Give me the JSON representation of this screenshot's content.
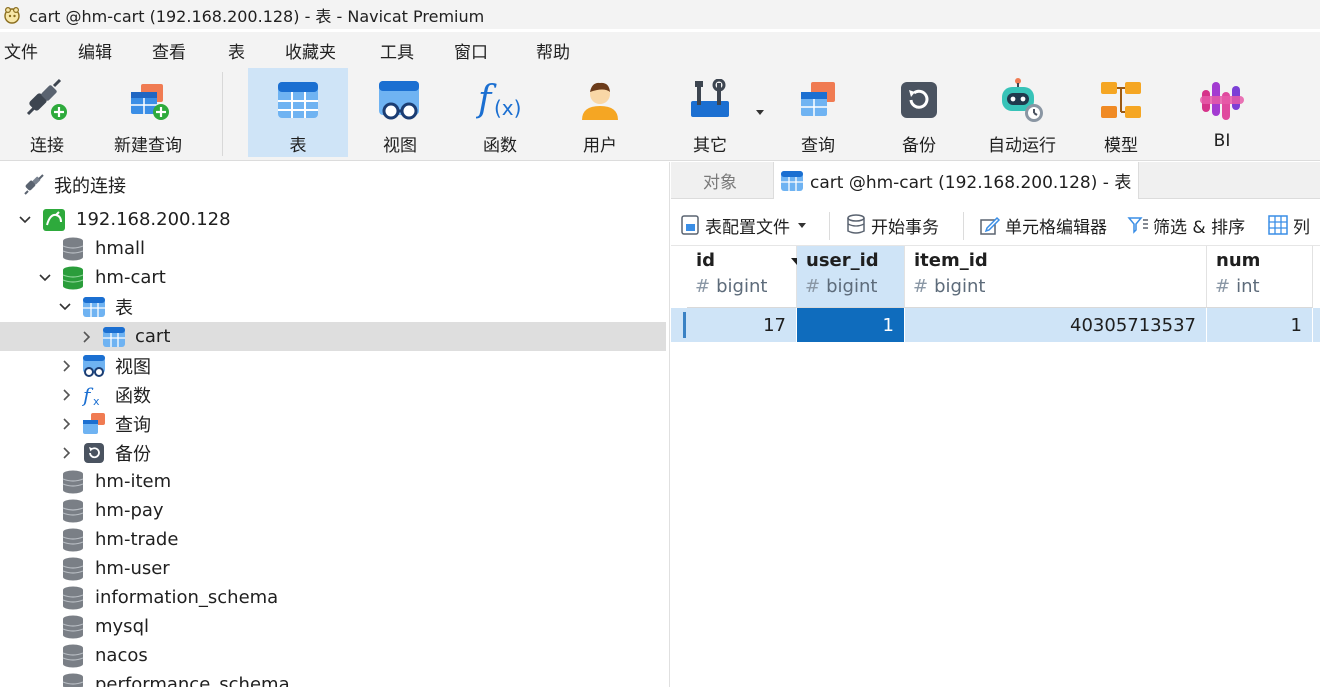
{
  "window": {
    "title": "cart @hm-cart (192.168.200.128) - 表 - Navicat Premium"
  },
  "menu": [
    "文件",
    "编辑",
    "查看",
    "表",
    "收藏夹",
    "工具",
    "窗口",
    "帮助"
  ],
  "toolbar": {
    "connect": "连接",
    "new_query": "新建查询",
    "table": "表",
    "view": "视图",
    "function": "函数",
    "user": "用户",
    "other": "其它",
    "query": "查询",
    "backup": "备份",
    "automation": "自动运行",
    "model": "模型",
    "bi": "BI"
  },
  "tree": {
    "root": "我的连接",
    "connection": "192.168.200.128",
    "items": {
      "hmall": "hmall",
      "hm_cart": "hm-cart",
      "tables": "表",
      "cart": "cart",
      "views": "视图",
      "functions": "函数",
      "queries": "查询",
      "backups": "备份",
      "hm_item": "hm-item",
      "hm_pay": "hm-pay",
      "hm_trade": "hm-trade",
      "hm_user": "hm-user",
      "information_schema": "information_schema",
      "mysql": "mysql",
      "nacos": "nacos",
      "performance_schema": "performance_schema"
    }
  },
  "tabs": {
    "objects": "对象",
    "active": "cart @hm-cart (192.168.200.128) - 表"
  },
  "subtoolbar": {
    "profile": "表配置文件",
    "begin_tx": "开始事务",
    "cell_editor": "单元格编辑器",
    "filter_sort": "筛选 & 排序",
    "columns": "列"
  },
  "grid": {
    "columns": [
      {
        "name": "id",
        "type": "bigint"
      },
      {
        "name": "user_id",
        "type": "bigint"
      },
      {
        "name": "item_id",
        "type": "bigint"
      },
      {
        "name": "num",
        "type": "int"
      }
    ],
    "rows": [
      [
        "17",
        "1",
        "40305713537",
        "1"
      ]
    ],
    "type_prefix": "#"
  },
  "colors": {
    "accent": "#0f6cbd",
    "selection": "#cfe4f7",
    "tree_selected": "#dedede"
  }
}
